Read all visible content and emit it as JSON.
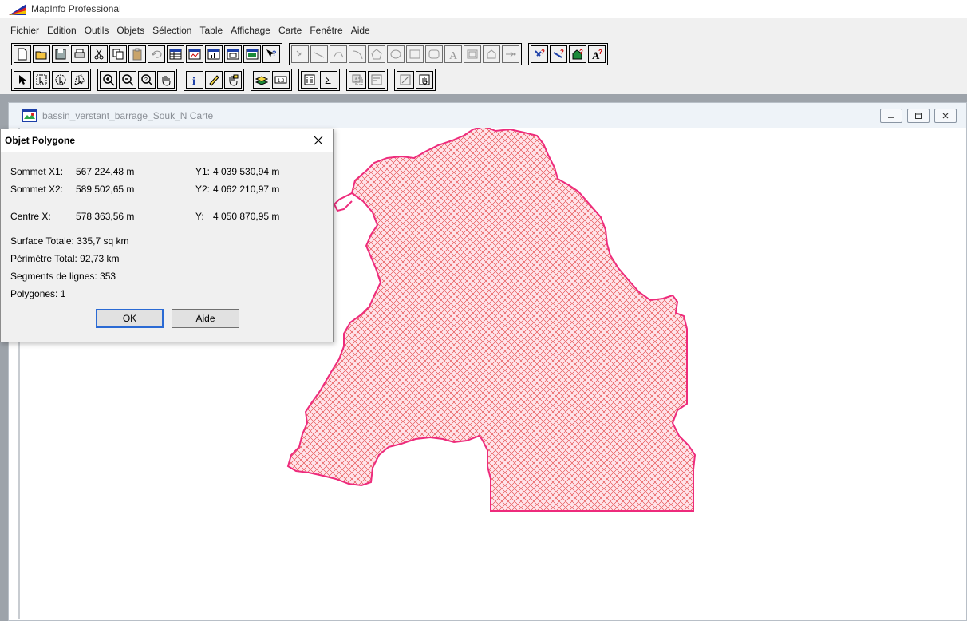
{
  "app": {
    "title": "MapInfo Professional"
  },
  "menu": [
    "Fichier",
    "Edition",
    "Outils",
    "Objets",
    "Sélection",
    "Table",
    "Affichage",
    "Carte",
    "Fenêtre",
    "Aide"
  ],
  "map_window": {
    "title": "bassin_verstant_barrage_Souk_N Carte"
  },
  "dialog": {
    "title": "Objet Polygone",
    "sommet_x1_label": "Sommet X1:",
    "sommet_x1_value": "567 224,48 m",
    "y1_label": "Y1:",
    "y1_value": "4 039 530,94 m",
    "sommet_x2_label": "Sommet X2:",
    "sommet_x2_value": "589 502,65 m",
    "y2_label": "Y2:",
    "y2_value": "4 062 210,97 m",
    "centre_x_label": "Centre X:",
    "centre_x_value": "578 363,56 m",
    "centre_y_label": "Y:",
    "centre_y_value": "4 050 870,95 m",
    "surface": "Surface Totale:  335,7 sq km",
    "perimetre": "Périmètre Total:  92,73 km",
    "segments": "Segments de lignes:  353",
    "polygones": "Polygones:  1",
    "ok_label": "OK",
    "aide_label": "Aide"
  },
  "colors": {
    "polygon_border": "#ee2b7c",
    "polygon_fill": "#ffe4ea",
    "hatch": "#e23a3a",
    "accent": "#2a6ad4"
  }
}
